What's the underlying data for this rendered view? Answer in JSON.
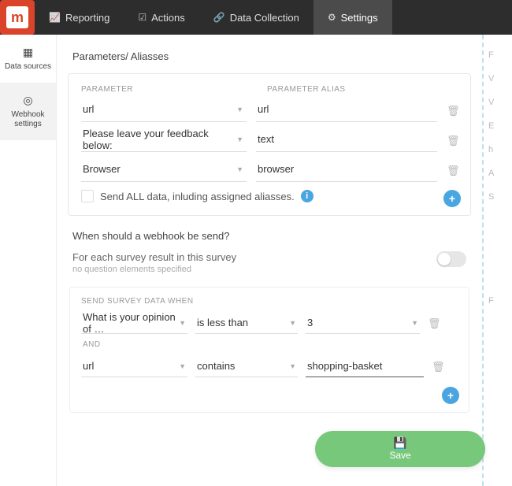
{
  "brand_letter": "m",
  "nav": {
    "items": [
      {
        "label": "Reporting"
      },
      {
        "label": "Actions"
      },
      {
        "label": "Data Collection"
      },
      {
        "label": "Settings"
      }
    ]
  },
  "sidebar": {
    "items": [
      {
        "label": "Data sources"
      },
      {
        "label": "Webhook settings"
      }
    ]
  },
  "params_card": {
    "title": "Parameters/ Aliasses",
    "header_param": "PARAMETER",
    "header_alias": "PARAMETER ALIAS",
    "rows": [
      {
        "param": "url",
        "alias": "url"
      },
      {
        "param": "Please leave your feedback below:",
        "alias": "text"
      },
      {
        "param": "Browser",
        "alias": "browser"
      }
    ],
    "send_all_label": "Send ALL data, inluding assigned aliasses."
  },
  "when_section": {
    "title": "When should a webhook be send?",
    "line1": "For each survey result in this survey",
    "note": "no question elements specified"
  },
  "conditions": {
    "header": "SEND SURVEY DATA WHEN",
    "rows": [
      {
        "field": "What is your opinion of …",
        "op": "is less than",
        "value": "3"
      },
      {
        "field": "url",
        "op": "contains",
        "value": "shopping-basket"
      }
    ],
    "and_label": "AND"
  },
  "right_letters": [
    "F",
    "V",
    "V",
    "E",
    "h",
    "A",
    "S",
    "F"
  ],
  "save_label": "Save"
}
